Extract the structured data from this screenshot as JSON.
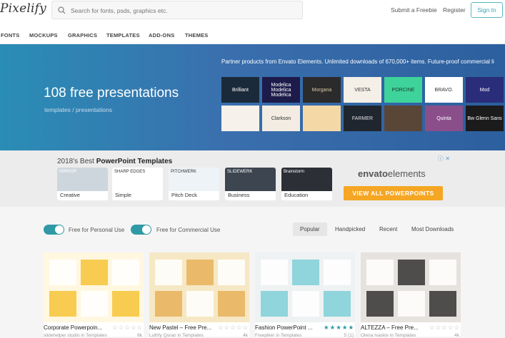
{
  "header": {
    "logo": "Pixelify",
    "search_placeholder": "Search for fonts, psds, graphics etc.",
    "submit": "Submit a Freebie",
    "register": "Register",
    "signin": "Sign In"
  },
  "nav": [
    "FONTS",
    "MOCKUPS",
    "GRAPHICS",
    "TEMPLATES",
    "ADD-ONS",
    "THEMES"
  ],
  "hero": {
    "title": "108 free presentations",
    "breadcrumb": "templates / presentations",
    "promo": "Partner products from Envato Elements. Unlimited downloads of 670,000+ items. Future-proof commercial li",
    "tiles": [
      {
        "text": "Brilliant",
        "bg": "#1b2a3a",
        "fg": "#ffffff"
      },
      {
        "text": "Modelica Modelica Modelica",
        "bg": "#1d1b4a",
        "fg": "#ffffff"
      },
      {
        "text": "Morgana",
        "bg": "#2b2b2b",
        "fg": "#d9c9a8"
      },
      {
        "text": "VESTA",
        "bg": "#f4efe7",
        "fg": "#333333"
      },
      {
        "text": "PORCINE",
        "bg": "#3ed39a",
        "fg": "#1a3a2a"
      },
      {
        "text": "BRAVO.",
        "bg": "#ffffff",
        "fg": "#333333"
      },
      {
        "text": "Mod",
        "bg": "#2a2d7a",
        "fg": "#ffffff"
      },
      {
        "text": "",
        "bg": "#f6f1ea",
        "fg": "#333333"
      },
      {
        "text": "Clarkson",
        "bg": "#f3ece2",
        "fg": "#333333"
      },
      {
        "text": "",
        "bg": "#f4d9a6",
        "fg": "#333333"
      },
      {
        "text": "FARMER",
        "bg": "#1f2630",
        "fg": "#e0e0e0"
      },
      {
        "text": "",
        "bg": "#5a4636",
        "fg": "#ffffff"
      },
      {
        "text": "Quinta",
        "bg": "#8a4f8b",
        "fg": "#ffffff"
      },
      {
        "text": "Bw Glenn Sans",
        "bg": "#1b1b1b",
        "fg": "#ffffff"
      }
    ]
  },
  "ad": {
    "title_prefix": "2018's Best ",
    "title_bold": "PowerPoint Templates",
    "info": "ⓘ ✕",
    "categories": [
      {
        "label": "Creative",
        "bg": "#cdd6dd",
        "fg": "#ffffff",
        "word": "MIRROR"
      },
      {
        "label": "Simple",
        "bg": "#ffffff",
        "fg": "#333333",
        "word": "SHARP EDGES"
      },
      {
        "label": "Pitch Deck",
        "bg": "#eef3f7",
        "fg": "#333333",
        "word": "PITCHWERK"
      },
      {
        "label": "Business",
        "bg": "#3c4550",
        "fg": "#ffffff",
        "word": "SLIDEWERK"
      },
      {
        "label": "Education",
        "bg": "#2c2f36",
        "fg": "#ffffff",
        "word": "Brainstorm"
      }
    ],
    "envato_brand": "envato",
    "envato_rest": "elements",
    "cta": "VIEW ALL POWERPOINTS"
  },
  "filters": {
    "personal": "Free for Personal Use",
    "commercial": "Free for Commercial Use",
    "sort": [
      "Popular",
      "Handpicked",
      "Recent",
      "Most Downloads"
    ],
    "active_sort": "Popular"
  },
  "cards": [
    {
      "title": "Corporate Powerpoin...",
      "author": "slidehelper studio in Templates",
      "count": "6k",
      "rating": 0,
      "bg": "#fff7e0",
      "accent": "#f7c436"
    },
    {
      "title": "New Pastel – Free Pre...",
      "author": "Luthfy Quran in Templates",
      "count": "4k",
      "rating": 0,
      "bg": "#f6e8c4",
      "accent": "#e7b25a"
    },
    {
      "title": "Fashion PowerPoint ...",
      "author": "Freepiker in Templates",
      "count": "5 (1)",
      "rating": 5,
      "bg": "#eef2f3",
      "accent": "#7ed0d6"
    },
    {
      "title": "ALTEZZA – Free Pre...",
      "author": "Olena Ivaskiv in Templates",
      "count": "4k",
      "rating": 0,
      "bg": "#e6e2de",
      "accent": "#333333"
    }
  ],
  "colors": {
    "accent": "#2f9aa6",
    "cta": "#f5a623",
    "hero": "#2c6fae"
  }
}
